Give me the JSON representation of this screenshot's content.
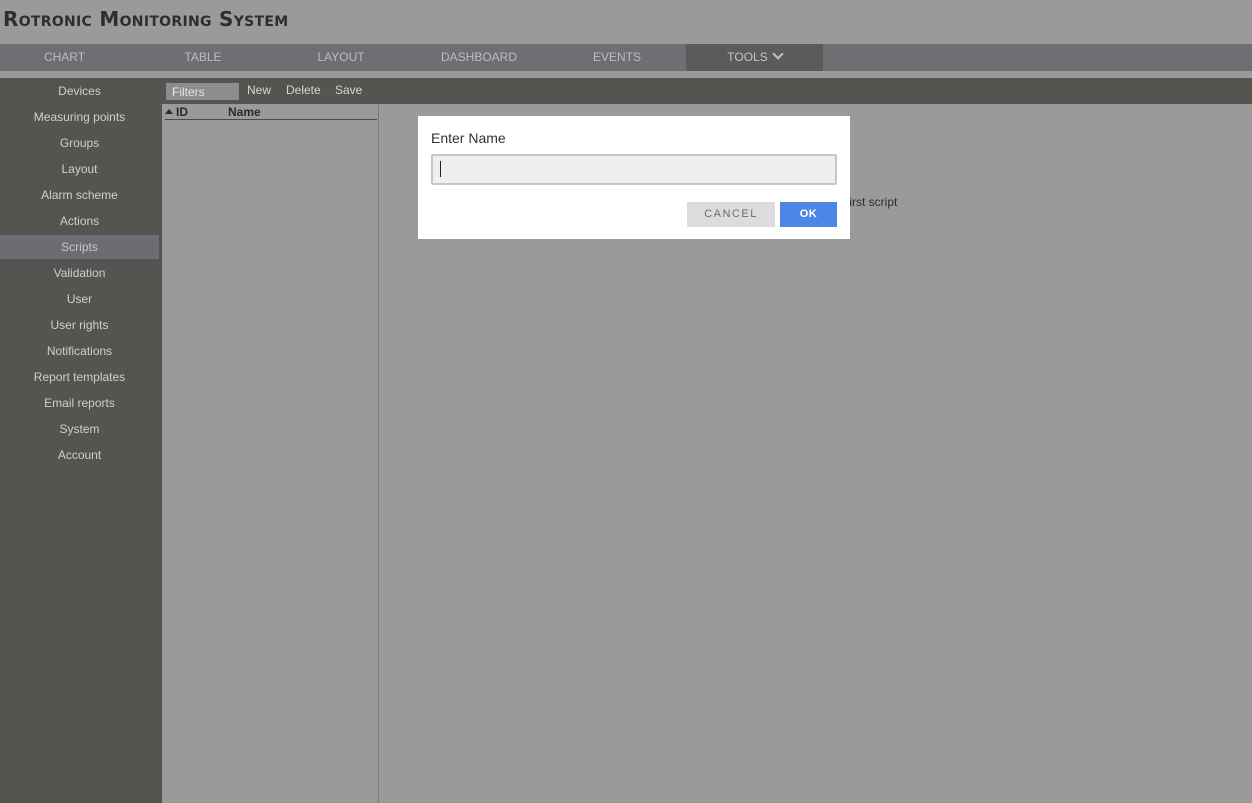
{
  "app": {
    "title": "Rotronic Monitoring System"
  },
  "nav": {
    "tabs": [
      {
        "label": "CHART"
      },
      {
        "label": "TABLE"
      },
      {
        "label": "LAYOUT"
      },
      {
        "label": "DASHBOARD"
      },
      {
        "label": "EVENTS"
      },
      {
        "label": "TOOLS",
        "active": true,
        "icon": "chevron-down-icon"
      }
    ]
  },
  "sidebar": {
    "items": [
      {
        "label": "Devices"
      },
      {
        "label": "Measuring points"
      },
      {
        "label": "Groups"
      },
      {
        "label": "Layout"
      },
      {
        "label": "Alarm scheme"
      },
      {
        "label": "Actions"
      },
      {
        "label": "Scripts",
        "active": true
      },
      {
        "label": "Validation"
      },
      {
        "label": "User"
      },
      {
        "label": "User rights"
      },
      {
        "label": "Notifications"
      },
      {
        "label": "Report templates"
      },
      {
        "label": "Email reports"
      },
      {
        "label": "System"
      },
      {
        "label": "Account"
      }
    ]
  },
  "toolbar": {
    "filter_placeholder": "Filters",
    "new_label": "New",
    "delete_label": "Delete",
    "save_label": "Save"
  },
  "list": {
    "columns": [
      {
        "label": "ID",
        "sort": "ascending"
      },
      {
        "label": "Name"
      }
    ],
    "rows": []
  },
  "content": {
    "hint_visible": "first script"
  },
  "dialog": {
    "title": "Enter Name",
    "input_value": "",
    "cancel_label": "CANCEL",
    "ok_label": "OK"
  },
  "colors": {
    "ok_button": "#4d86e7",
    "sidebar_bg": "#545450",
    "navbar_bg": "#6e6f73"
  }
}
